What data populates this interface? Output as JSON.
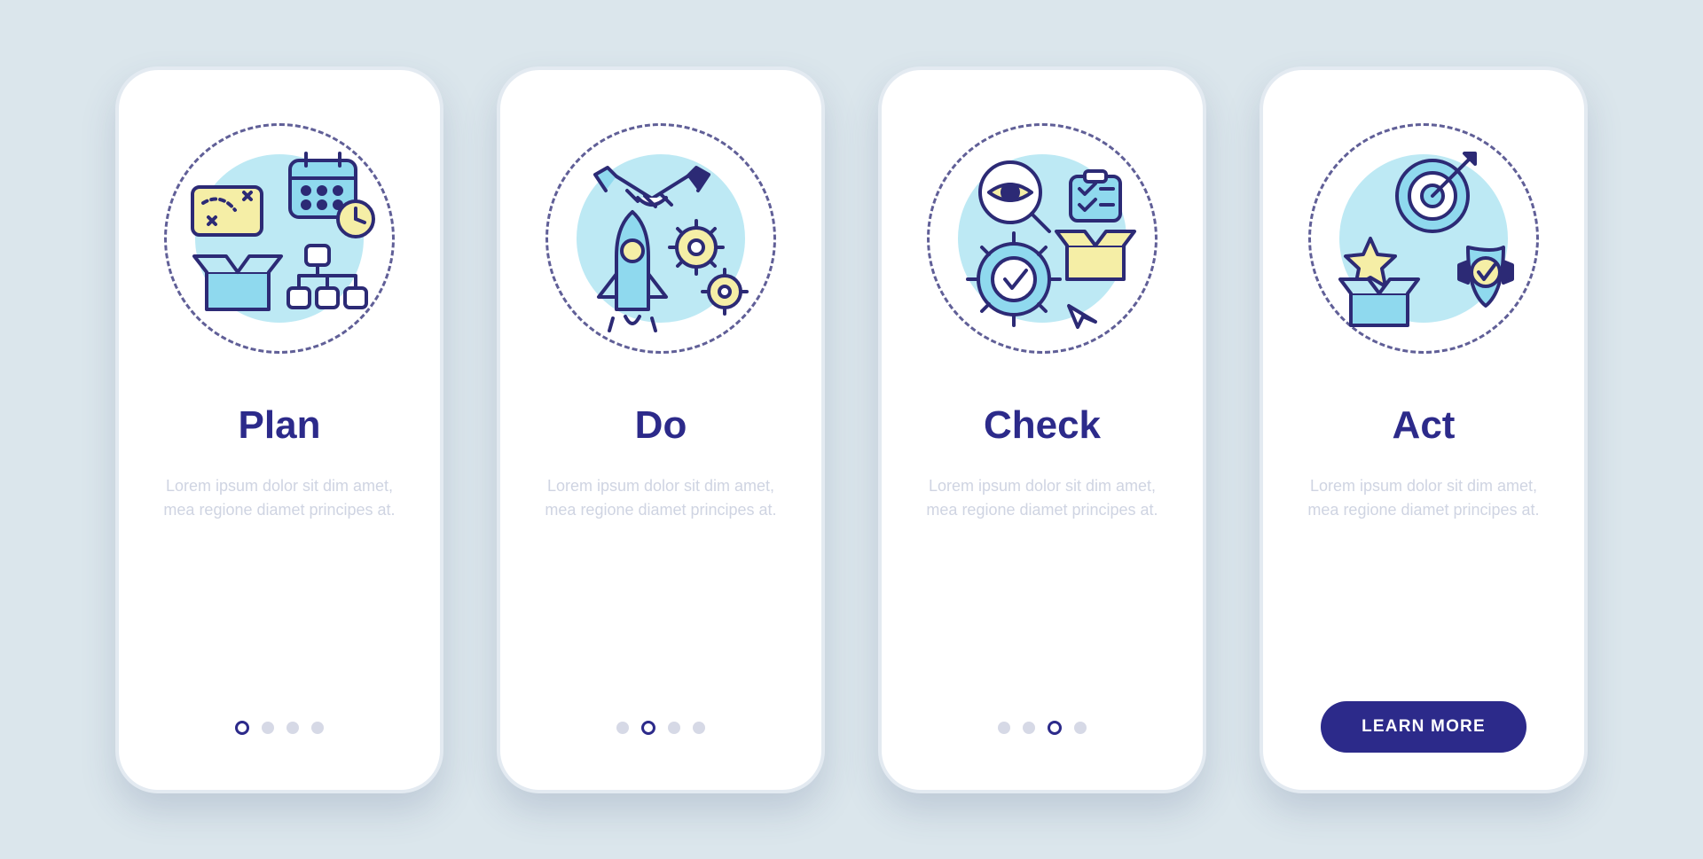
{
  "screens": [
    {
      "title": "Plan",
      "description": "Lorem ipsum dolor sit dim amet, mea regione diamet principes at."
    },
    {
      "title": "Do",
      "description": "Lorem ipsum dolor sit dim amet, mea regione diamet principes at."
    },
    {
      "title": "Check",
      "description": "Lorem ipsum dolor sit dim amet, mea regione diamet principes at."
    },
    {
      "title": "Act",
      "description": "Lorem ipsum dolor sit dim amet, mea regione diamet principes at."
    }
  ],
  "cta": {
    "learn_more": "LEARN MORE"
  },
  "colors": {
    "stroke": "#2c2a75",
    "blue_light": "#8fd9ee",
    "blue_fill": "#bde9f4",
    "yellow": "#f5eea6",
    "indigo": "#2c2a8a"
  }
}
